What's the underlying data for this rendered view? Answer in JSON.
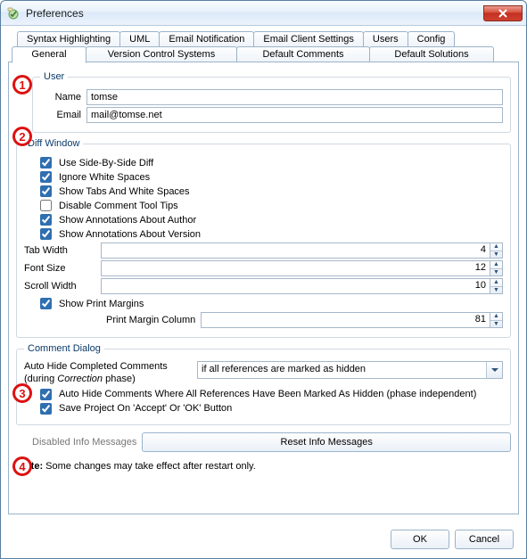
{
  "window": {
    "title": "Preferences"
  },
  "tabs_top": [
    "Syntax Highlighting",
    "UML",
    "Email Notification",
    "Email Client Settings",
    "Users",
    "Config"
  ],
  "tabs_bottom": [
    "General",
    "Version Control Systems",
    "Default Comments",
    "Default Solutions"
  ],
  "user": {
    "legend": "User",
    "name_label": "Name",
    "name_value": "tomse",
    "email_label": "Email",
    "email_value": "mail@tomse.net"
  },
  "diff": {
    "legend": "Diff Window",
    "use_sbs": "Use Side-By-Side Diff",
    "ignore_ws": "Ignore White Spaces",
    "show_tabs": "Show Tabs And White Spaces",
    "disable_tips": "Disable Comment Tool Tips",
    "ann_author": "Show Annotations About Author",
    "ann_version": "Show Annotations About Version",
    "tab_width_label": "Tab Width",
    "tab_width_value": "4",
    "font_size_label": "Font Size",
    "font_size_value": "12",
    "scroll_width_label": "Scroll Width",
    "scroll_width_value": "10",
    "show_print": "Show Print Margins",
    "print_col_label": "Print Margin Column",
    "print_col_value": "81"
  },
  "comment": {
    "legend": "Comment Dialog",
    "auto_hide_label_1": "Auto Hide Completed Comments",
    "auto_hide_label_2a": "(during ",
    "auto_hide_label_2b": "Correction",
    "auto_hide_label_2c": " phase)",
    "combo_value": "if all references are marked as hidden",
    "ahc_all": "Auto Hide Comments Where All References Have Been Marked As Hidden (phase independent)",
    "save_project": "Save Project On 'Accept' Or 'OK' Button"
  },
  "disabled_msgs_label": "Disabled Info Messages",
  "reset_btn": "Reset Info Messages",
  "note_bold": "Note:",
  "note_text": " Some changes may take effect after restart only.",
  "buttons": {
    "ok": "OK",
    "cancel": "Cancel"
  },
  "callouts": [
    "1",
    "2",
    "3",
    "4"
  ]
}
